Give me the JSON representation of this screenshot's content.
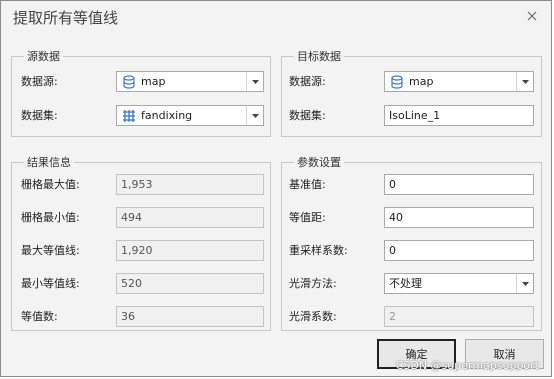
{
  "window": {
    "title": "提取所有等值线"
  },
  "source_group": {
    "legend": "源数据",
    "datasource_label": "数据源:",
    "datasource_value": "map",
    "dataset_label": "数据集:",
    "dataset_value": "fandixing"
  },
  "target_group": {
    "legend": "目标数据",
    "datasource_label": "数据源:",
    "datasource_value": "map",
    "dataset_label": "数据集:",
    "dataset_value": "IsoLine_1"
  },
  "result_group": {
    "legend": "结果信息",
    "rows": [
      {
        "label": "栅格最大值:",
        "value": "1,953"
      },
      {
        "label": "栅格最小值:",
        "value": "494"
      },
      {
        "label": "最大等值线:",
        "value": "1,920"
      },
      {
        "label": "最小等值线:",
        "value": "520"
      },
      {
        "label": "等值数:",
        "value": "36"
      }
    ]
  },
  "params_group": {
    "legend": "参数设置",
    "base_label": "基准值:",
    "base_value": "0",
    "interval_label": "等值距:",
    "interval_value": "40",
    "resample_label": "重采样系数:",
    "resample_value": "0",
    "smooth_method_label": "光滑方法:",
    "smooth_method_value": "不处理",
    "smooth_factor_label": "光滑系数:",
    "smooth_factor_value": "2"
  },
  "buttons": {
    "ok": "确定",
    "cancel": "取消"
  },
  "watermark": "CSDN @supermapsupport",
  "icons": {
    "close": "close-icon",
    "datasource": "database-icon",
    "dataset": "grid-dataset-icon",
    "dropdown": "chevron-down-icon"
  },
  "colors": {
    "database_icon": "#3a7bd5",
    "grid_icon": "#2f6fcf"
  }
}
